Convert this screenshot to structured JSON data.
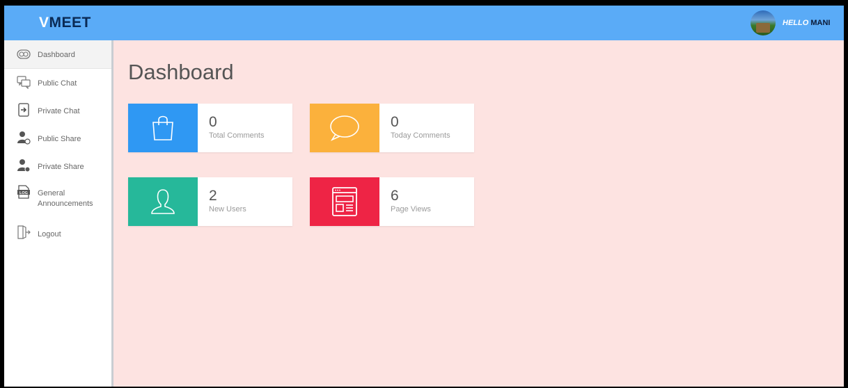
{
  "header": {
    "brand_first": "V",
    "brand_rest": "MEET",
    "greeting": "HELLO",
    "user": "MANI"
  },
  "sidebar": {
    "items": [
      {
        "label": "Dashboard",
        "icon": "dashboard-icon"
      },
      {
        "label": "Public Chat",
        "icon": "chat-bubbles-icon"
      },
      {
        "label": "Private Chat",
        "icon": "sign-in-icon"
      },
      {
        "label": "Public Share",
        "icon": "user-share-icon"
      },
      {
        "label": "Private Share",
        "icon": "user-lock-icon"
      },
      {
        "label": "General",
        "label2": "Announcements",
        "icon": "log-file-icon"
      },
      {
        "label": "Logout",
        "icon": "logout-icon"
      }
    ]
  },
  "main": {
    "title": "Dashboard",
    "stats": [
      {
        "value": "0",
        "label": "Total Comments",
        "icon": "shopping-bag-icon",
        "color": "#2f98f3"
      },
      {
        "value": "0",
        "label": "Today Comments",
        "icon": "speech-bubble-icon",
        "color": "#fbb13c"
      },
      {
        "value": "2",
        "label": "New Users",
        "icon": "user-icon",
        "color": "#26b89a"
      },
      {
        "value": "6",
        "label": "Page Views",
        "icon": "browser-window-icon",
        "color": "#ee2445"
      }
    ]
  },
  "colors": {
    "topbar": "#5aabf7",
    "background": "#fde3e1",
    "sidebar": "#ffffff"
  }
}
